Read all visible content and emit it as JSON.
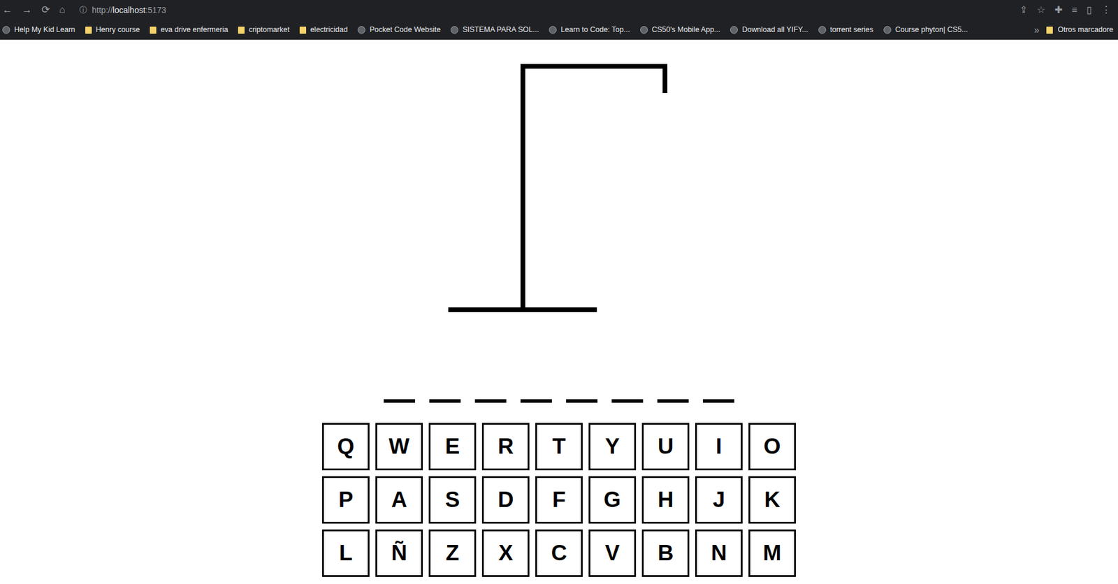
{
  "browser": {
    "nav": [
      "←",
      "→",
      "⟳",
      "⌂"
    ],
    "info_icon": "ⓘ",
    "url": {
      "scheme": "http://",
      "host": "localhost",
      "port": ":5173"
    },
    "right_icons": [
      "⇪",
      "☆",
      "✚",
      "≡",
      "▯",
      "⋮"
    ],
    "bookmarks": [
      {
        "label": "Help My Kid Learn",
        "kind": "site"
      },
      {
        "label": "Henry course",
        "kind": "folder"
      },
      {
        "label": "eva drive enfermeria",
        "kind": "folder"
      },
      {
        "label": "criptomarket",
        "kind": "folder"
      },
      {
        "label": "electricidad",
        "kind": "folder"
      },
      {
        "label": "Pocket Code Website",
        "kind": "site"
      },
      {
        "label": "SISTEMA PARA SOL...",
        "kind": "site"
      },
      {
        "label": "Learn to Code: Top...",
        "kind": "site"
      },
      {
        "label": "CS50's Mobile App...",
        "kind": "site"
      },
      {
        "label": "Download all YIFY...",
        "kind": "site"
      },
      {
        "label": "torrent series",
        "kind": "site"
      },
      {
        "label": "Course phyton| CS5...",
        "kind": "site"
      }
    ],
    "more": "»",
    "other_bookmarks": "Otros marcadore"
  },
  "game": {
    "wrong_guesses": 0,
    "blanks": [
      {
        "revealed": false
      },
      {
        "revealed": false
      },
      {
        "revealed": false
      },
      {
        "revealed": false
      },
      {
        "revealed": false
      },
      {
        "revealed": false
      },
      {
        "revealed": false
      },
      {
        "revealed": false
      }
    ],
    "keyboard": [
      [
        {
          "key": "Q",
          "disabled": false
        },
        {
          "key": "W",
          "disabled": false
        },
        {
          "key": "E",
          "disabled": false
        },
        {
          "key": "R",
          "disabled": false
        },
        {
          "key": "T",
          "disabled": false
        },
        {
          "key": "Y",
          "disabled": false
        },
        {
          "key": "U",
          "disabled": false
        },
        {
          "key": "I",
          "disabled": false
        },
        {
          "key": "O",
          "disabled": false
        }
      ],
      [
        {
          "key": "P",
          "disabled": false
        },
        {
          "key": "A",
          "disabled": false
        },
        {
          "key": "S",
          "disabled": false
        },
        {
          "key": "D",
          "disabled": false
        },
        {
          "key": "F",
          "disabled": false
        },
        {
          "key": "G",
          "disabled": false
        },
        {
          "key": "H",
          "disabled": false
        },
        {
          "key": "J",
          "disabled": false
        },
        {
          "key": "K",
          "disabled": false
        }
      ],
      [
        {
          "key": "L",
          "disabled": false
        },
        {
          "key": "Ñ",
          "disabled": false
        },
        {
          "key": "Z",
          "disabled": false
        },
        {
          "key": "X",
          "disabled": false
        },
        {
          "key": "C",
          "disabled": false
        },
        {
          "key": "V",
          "disabled": false
        },
        {
          "key": "B",
          "disabled": false
        },
        {
          "key": "N",
          "disabled": false
        },
        {
          "key": "M",
          "disabled": false
        }
      ]
    ]
  }
}
